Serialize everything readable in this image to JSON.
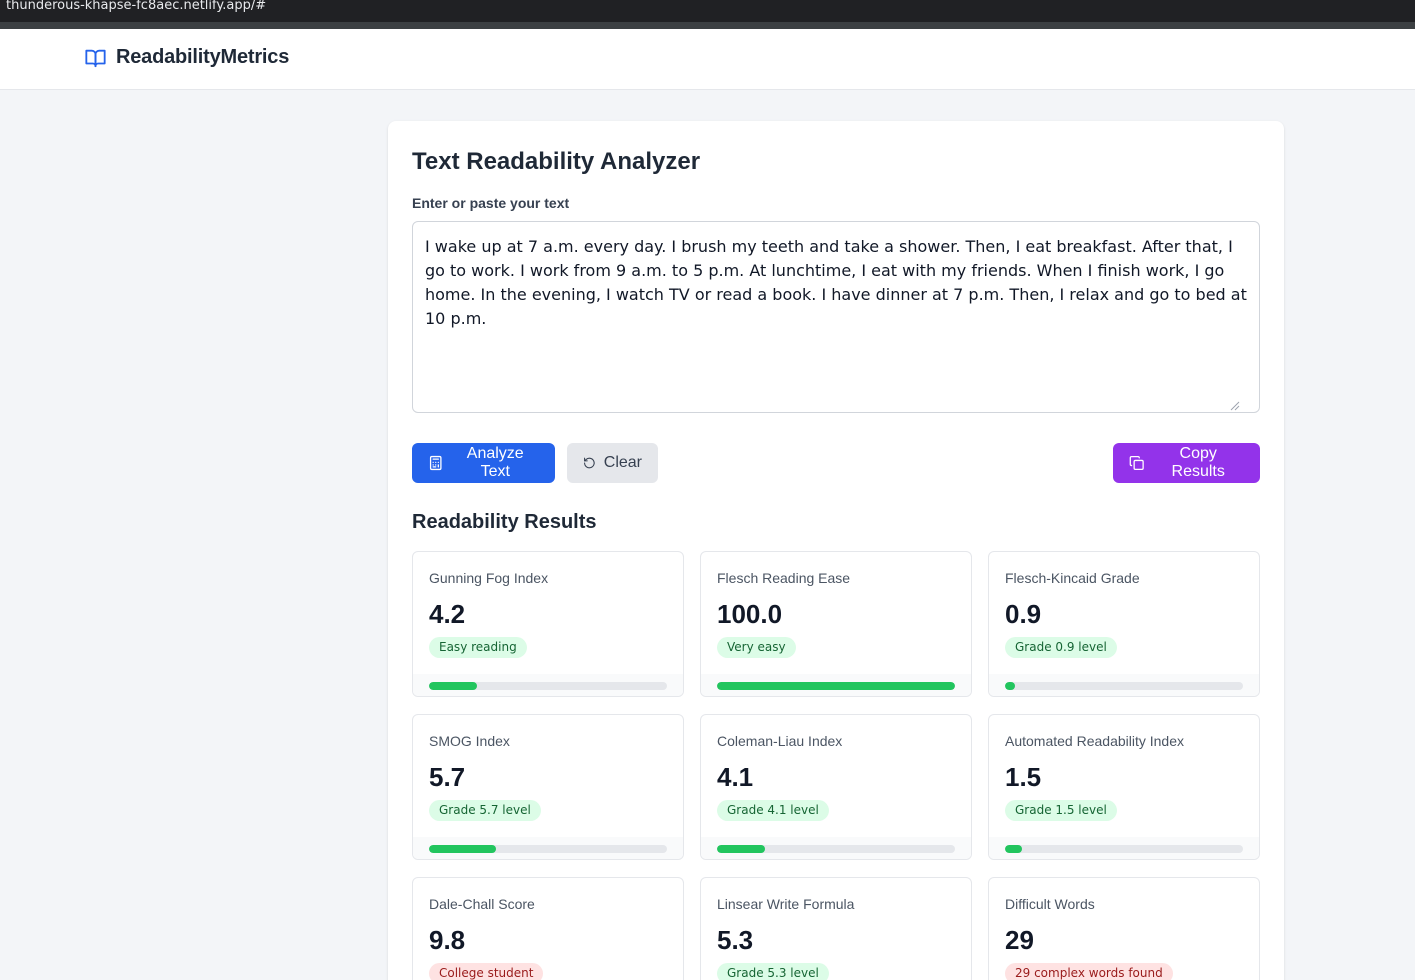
{
  "browser": {
    "url": "thunderous-khapse-fc8aec.netlify.app/#"
  },
  "brand": {
    "name": "ReadabilityMetrics",
    "icon": "open-book-icon",
    "color": "#2563eb"
  },
  "analyzer": {
    "title": "Text Readability Analyzer",
    "input_label": "Enter or paste your text",
    "input_text": "I wake up at 7 a.m. every day. I brush my teeth and take a shower. Then, I eat breakfast. After that, I go to work. I work from 9 a.m. to 5 p.m. At lunchtime, I eat with my friends. When I finish work, I go home. In the evening, I watch TV or read a book. I have dinner at 7 p.m. Then, I relax and go to bed at 10 p.m."
  },
  "buttons": {
    "analyze": {
      "label": "Analyze Text",
      "icon": "calculator-icon",
      "color": "#2563eb"
    },
    "clear": {
      "label": "Clear",
      "icon": "rotate-ccw-icon",
      "color": "#e5e7eb"
    },
    "copy": {
      "label": "Copy Results",
      "icon": "copy-icon",
      "color": "#9333ea"
    }
  },
  "results": {
    "title": "Readability Results",
    "metrics": [
      {
        "name": "Gunning Fog Index",
        "value": "4.2",
        "badge": "Easy reading",
        "tone": "green",
        "progress": 0.2
      },
      {
        "name": "Flesch Reading Ease",
        "value": "100.0",
        "badge": "Very easy",
        "tone": "green",
        "progress": 1.0
      },
      {
        "name": "Flesch-Kincaid Grade",
        "value": "0.9",
        "badge": "Grade 0.9 level",
        "tone": "green",
        "progress": 0.04
      },
      {
        "name": "SMOG Index",
        "value": "5.7",
        "badge": "Grade 5.7 level",
        "tone": "green",
        "progress": 0.28
      },
      {
        "name": "Coleman-Liau Index",
        "value": "4.1",
        "badge": "Grade 4.1 level",
        "tone": "green",
        "progress": 0.2
      },
      {
        "name": "Automated Readability Index",
        "value": "1.5",
        "badge": "Grade 1.5 level",
        "tone": "green",
        "progress": 0.07
      },
      {
        "name": "Dale-Chall Score",
        "value": "9.8",
        "badge": "College student",
        "tone": "red",
        "progress": null
      },
      {
        "name": "Linsear Write Formula",
        "value": "5.3",
        "badge": "Grade 5.3 level",
        "tone": "green",
        "progress": null
      },
      {
        "name": "Difficult Words",
        "value": "29",
        "badge": "29 complex words found",
        "tone": "red",
        "progress": null
      }
    ]
  },
  "colors": {
    "success": "#22c55e",
    "danger_bg": "#fee2e2",
    "success_bg": "#dcfce7"
  }
}
